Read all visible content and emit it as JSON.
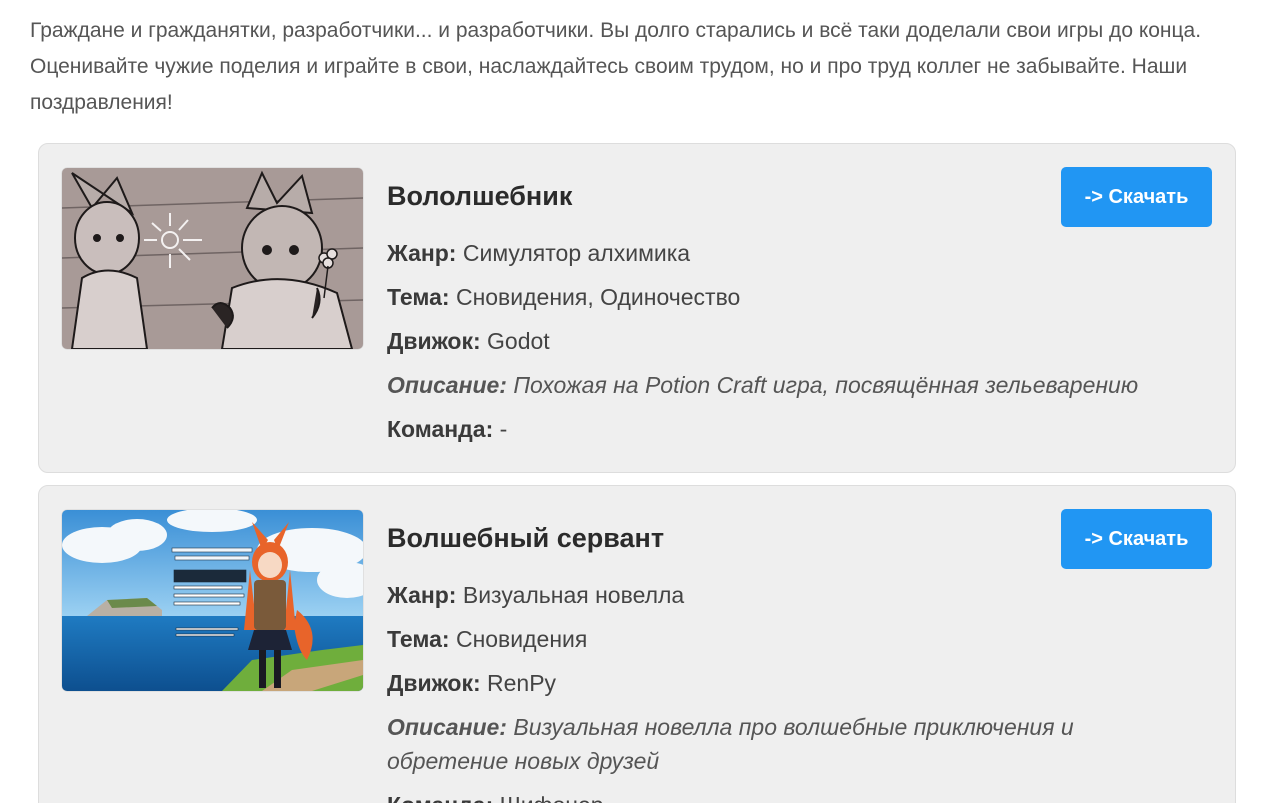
{
  "intro": "Граждане и гражданятки, разработчики... и разработчики. Вы долго старались и всё таки доделали свои игры до конца. Оценивайте чужие поделия и играйте в свои, наслаждайтесь своим трудом, но и про труд коллег не забывайте. Наши поздравления!",
  "labels": {
    "genre": "Жанр:",
    "theme": "Тема:",
    "engine": "Движок:",
    "description": "Описание:",
    "team": "Команда:"
  },
  "games": [
    {
      "title": "Вололшебник",
      "download_label": "-> Скачать",
      "genre": "Симулятор алхимика",
      "theme": "Сновидения, Одиночество",
      "engine": "Godot",
      "description": "Похожая на Potion Craft игра, посвящённая зельеварению",
      "team": "-",
      "thumbnail": "sketch-two-foxgirls"
    },
    {
      "title": "Волшебный сервант",
      "download_label": "-> Скачать",
      "genre": "Визуальная новелла",
      "theme": "Сновидения",
      "engine": "RenPy",
      "description": "Визуальная новелла про волшебные приключения и обретение новых друзей",
      "team": "Шифонер",
      "thumbnail": "foxgirl-seaside-title",
      "thumbnail_text": "Волшебный сервант"
    }
  ]
}
